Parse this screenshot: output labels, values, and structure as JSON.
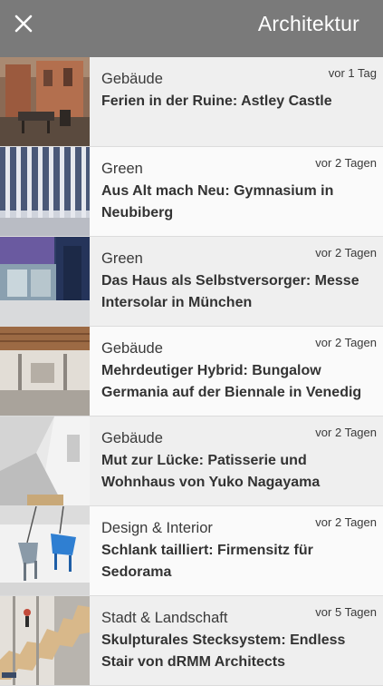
{
  "header": {
    "title": "Architektur",
    "close_icon": "close-icon",
    "background": "#7a7a7a"
  },
  "articles": [
    {
      "category": "Gebäude",
      "time": "vor 1 Tag",
      "headline": "Ferien in der Ruine: Astley Castle",
      "image": "ruin-castle-photo"
    },
    {
      "category": "Green",
      "time": "vor 2 Tagen",
      "headline": "Aus Alt mach Neu: Gymnasium in Neubiberg",
      "image": "school-facade-photo"
    },
    {
      "category": "Green",
      "time": "vor 2 Tagen",
      "headline": "Das Haus als Selbstversorger: Messe Intersolar in München",
      "image": "solar-house-photo"
    },
    {
      "category": "Gebäude",
      "time": "vor 2 Tagen",
      "headline": "Mehrdeutiger Hybrid: Bungalow Germania auf der Biennale in Venedig",
      "image": "bungalow-interior-photo"
    },
    {
      "category": "Gebäude",
      "time": "vor 2 Tagen",
      "headline": "Mut zur Lücke: Patisserie und Wohnhaus von Yuko Nagayama",
      "image": "patisserie-interior-photo"
    },
    {
      "category": "Design & Interior",
      "time": "vor 2 Tagen",
      "headline": "Schlank tailliert: Firmensitz für Sedorama",
      "image": "hanging-chairs-photo"
    },
    {
      "category": "Stadt & Landschaft",
      "time": "vor 5 Tagen",
      "headline": "Skulpturales Stecksystem: Endless Stair von dRMM Architects",
      "image": "endless-stair-photo"
    }
  ]
}
